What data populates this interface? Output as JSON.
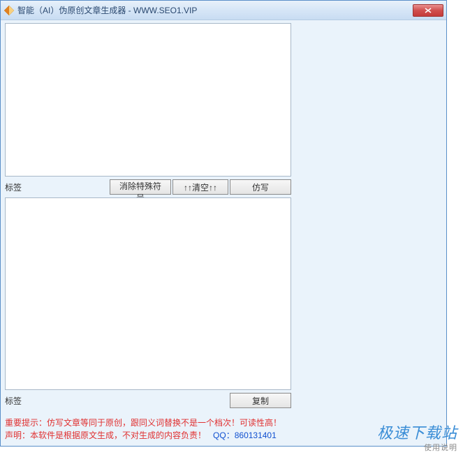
{
  "titlebar": {
    "title": "智能（AI）伪原创文章生成器 - WWW.SEO1.VIP",
    "close": "X"
  },
  "input": {
    "label": "标签",
    "value": ""
  },
  "buttons": {
    "remove_special": "消除特殊符号",
    "clear": "↑↑清空↑↑",
    "rewrite": "仿写",
    "copy": "复制"
  },
  "output": {
    "label": "标签",
    "value": ""
  },
  "notice": {
    "line1_prefix": "重要提示：",
    "line1_text": "仿写文章等同于原创，跟同义词替换不是一个档次！可读性高！",
    "line2_prefix": "声明：",
    "line2_text": "本软件是根据原文生成，不对生成的内容负责！",
    "qq_label": "QQ：",
    "qq_value": "860131401"
  },
  "watermark": {
    "main": "极速下载站",
    "sub": "使用说明"
  }
}
